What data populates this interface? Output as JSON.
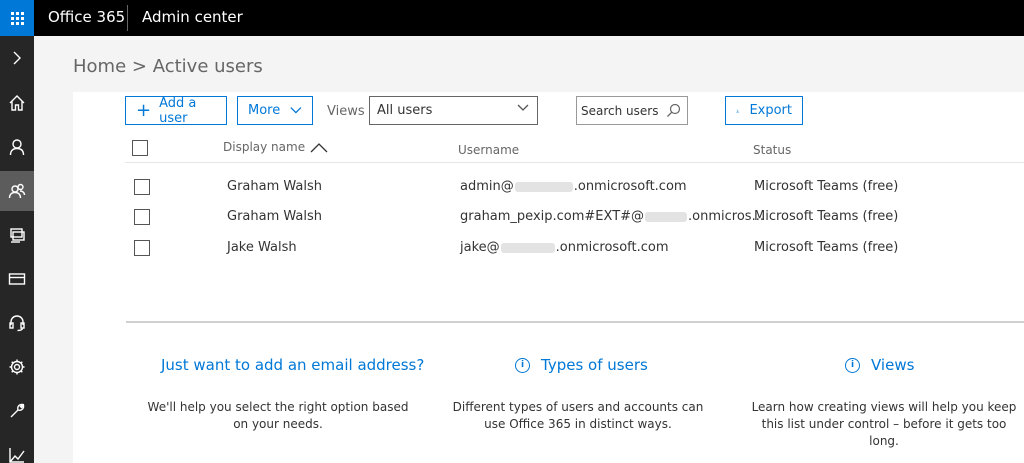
{
  "topbar": {
    "waffle_icon": "app-launcher-icon",
    "app_name": "Office 365",
    "section": "Admin center"
  },
  "sidebar": {
    "items": [
      {
        "icon": "chevron-right-icon",
        "name": "expand"
      },
      {
        "icon": "home-icon",
        "name": "home"
      },
      {
        "icon": "user-icon",
        "name": "users"
      },
      {
        "icon": "groups-icon",
        "name": "groups",
        "active": true
      },
      {
        "icon": "resources-icon",
        "name": "resources"
      },
      {
        "icon": "billing-icon",
        "name": "billing"
      },
      {
        "icon": "support-icon",
        "name": "support"
      },
      {
        "icon": "settings-icon",
        "name": "settings"
      },
      {
        "icon": "setup-icon",
        "name": "setup"
      },
      {
        "icon": "reports-icon",
        "name": "reports"
      }
    ]
  },
  "breadcrumb": {
    "home": "Home",
    "separator": ">",
    "current": "Active users"
  },
  "toolbar": {
    "add_user": "Add a user",
    "more": "More",
    "views_label": "Views",
    "views_selected": "All users",
    "search_placeholder": "Search users",
    "export": "Export"
  },
  "table": {
    "columns": {
      "display_name": "Display name",
      "username": "Username",
      "status": "Status"
    },
    "rows": [
      {
        "display_name": "Graham Walsh",
        "username_prefix": "admin@",
        "username_suffix": ".onmicrosoft.com",
        "status": "Microsoft Teams (free)"
      },
      {
        "display_name": "Graham Walsh",
        "username_prefix": "graham_pexip.com#EXT#@",
        "username_suffix": ".onmicros...",
        "status": "Microsoft Teams (free)"
      },
      {
        "display_name": "Jake Walsh",
        "username_prefix": "jake@",
        "username_suffix": ".onmicrosoft.com",
        "status": "Microsoft Teams (free)"
      }
    ]
  },
  "info": {
    "email": {
      "title": "Just want to add an email address?",
      "body": "We'll help you select the right option based on your needs."
    },
    "types": {
      "title": "Types of users",
      "body": "Different types of users and accounts can use Office 365 in distinct ways."
    },
    "views": {
      "title": "Views",
      "body": "Learn how creating views will help you keep this list under control – before it gets too long."
    }
  },
  "colors": {
    "accent": "#0078d7",
    "topbar": "#000000",
    "sidebar": "#262626",
    "sidebar_active": "#5c5c5c"
  }
}
